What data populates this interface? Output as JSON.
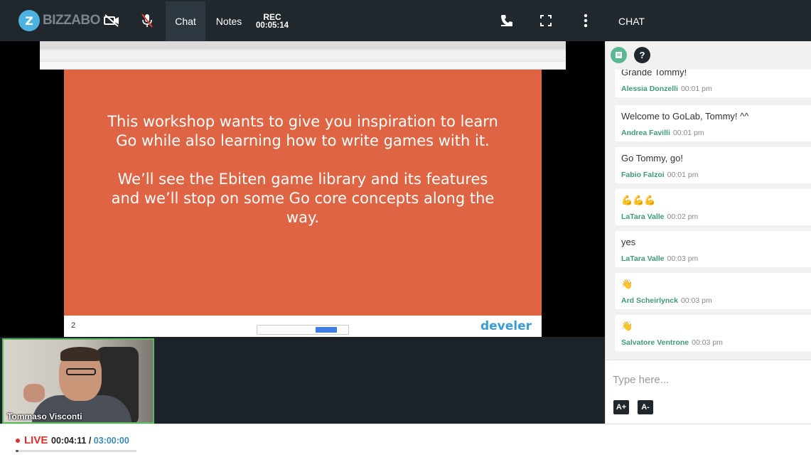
{
  "app": {
    "brand": "BIZZABO",
    "badge": "Z"
  },
  "toolbar": {
    "tabs": [
      {
        "label": "Chat",
        "active": true
      },
      {
        "label": "Notes",
        "active": false
      }
    ],
    "rec_label": "REC",
    "rec_time": "00:05:14",
    "chat_title": "CHAT"
  },
  "stage": {
    "slide": {
      "paragraphs": [
        "This workshop wants to give you inspiration to learn Go while also learning how to write games with it.",
        "We’ll see the Ebiten game library and its features and we’ll stop on some Go core concepts along the way."
      ],
      "page_number": "2",
      "brand": "develer",
      "background_color": "#de6443"
    },
    "speaker_name": "Tommaso Visconti"
  },
  "chat": {
    "help_label": "?",
    "messages": [
      {
        "text": "Grande Tommy!",
        "author": "Alessia Donzelli",
        "time": "00:01 pm"
      },
      {
        "text": "Welcome to GoLab, Tommy! ^^",
        "author": "Andrea Favilli",
        "time": "00:01 pm"
      },
      {
        "text": "Go Tommy, go!",
        "author": "Fabio Falzoi",
        "time": "00:01 pm"
      },
      {
        "text": "💪💪💪",
        "author": "LaTara Valle",
        "time": "00:02 pm"
      },
      {
        "text": "yes",
        "author": "LaTara Valle",
        "time": "00:03 pm"
      },
      {
        "text": "👋",
        "author": "Ard Scheirlynck",
        "time": "00:03 pm"
      },
      {
        "text": "👋",
        "author": "Salvatore Ventrone",
        "time": "00:03 pm"
      }
    ],
    "compose_placeholder": "Type here...",
    "font_increase": "A+",
    "font_decrease": "A-",
    "author_color": "#3f9a72"
  },
  "live": {
    "label": "LIVE",
    "elapsed": "00:04:11",
    "separator": " / ",
    "total": "03:00:00",
    "progress_fraction": 0.023,
    "status_color": "#d9312b"
  }
}
